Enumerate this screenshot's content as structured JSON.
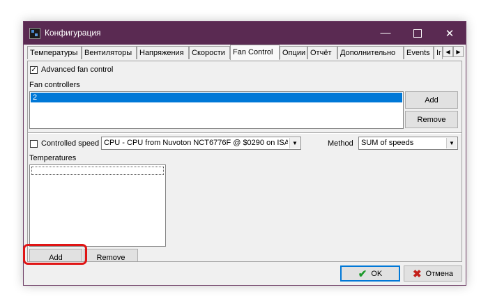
{
  "window": {
    "title": "Конфигурация"
  },
  "tabs": [
    "Температуры",
    "Вентиляторы",
    "Напряжения",
    "Скорости",
    "Fan Control",
    "Опции",
    "Отчёт",
    "Дополнительно",
    "Events",
    "Ir"
  ],
  "advanced": {
    "label": "Advanced fan control",
    "checked": "✓"
  },
  "fan_controllers": {
    "label": "Fan controllers",
    "items": [
      "2"
    ],
    "add": "Add",
    "remove": "Remove"
  },
  "controlled_speed": {
    "label": "Controlled speed",
    "value": "CPU - CPU from Nuvoton NCT6776F @ $0290 on ISA"
  },
  "method": {
    "label": "Method",
    "value": "SUM of speeds"
  },
  "temperatures": {
    "label": "Temperatures",
    "add": "Add",
    "remove": "Remove"
  },
  "footer": {
    "ok": "OK",
    "cancel": "Отмена"
  },
  "colors": {
    "titlebar": "#5a2a52",
    "selection": "#0078d7",
    "highlight": "#e01515"
  }
}
